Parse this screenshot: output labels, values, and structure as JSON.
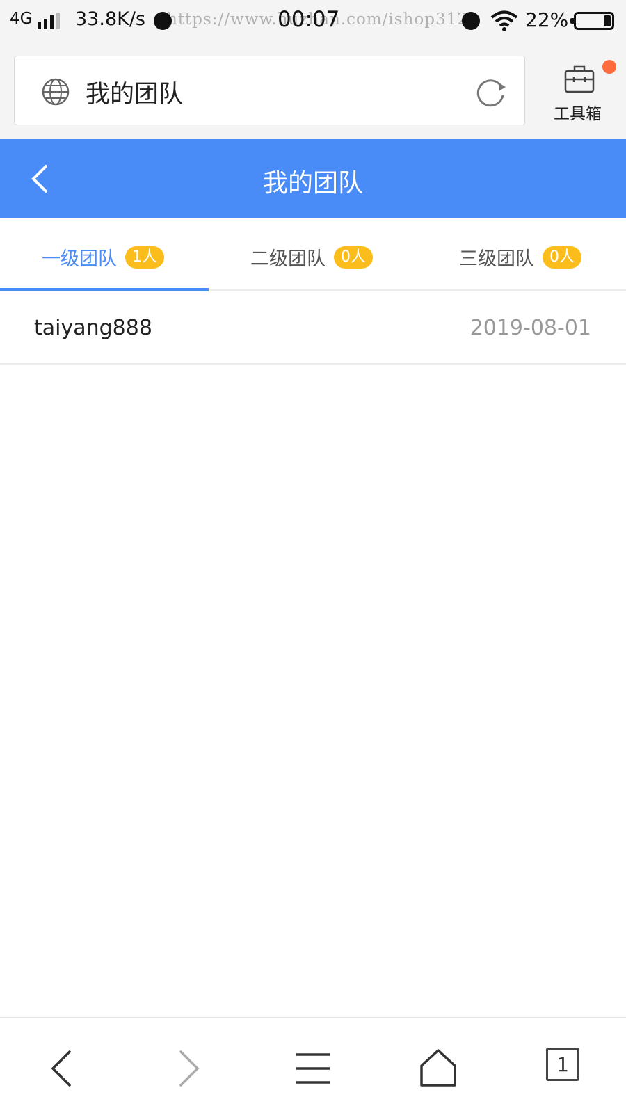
{
  "status_bar": {
    "network": "4G",
    "speed": "33.8K/s",
    "url_watermark": "https://www.huzhan.com/ishop3129",
    "time": "00:07",
    "battery": "22%"
  },
  "browser": {
    "address_title": "我的团队",
    "toolbox_label": "工具箱"
  },
  "header": {
    "title": "我的团队"
  },
  "tabs": [
    {
      "label": "一级团队",
      "badge": "1人",
      "active": true
    },
    {
      "label": "二级团队",
      "badge": "0人",
      "active": false
    },
    {
      "label": "三级团队",
      "badge": "0人",
      "active": false
    }
  ],
  "members": [
    {
      "name": "taiyang888",
      "date": "2019-08-01"
    }
  ],
  "bottom_nav": {
    "tabs_count": "1"
  },
  "colors": {
    "accent": "#4a8cf7",
    "badge": "#fbbd1c",
    "notification_dot": "#ff6b3d"
  }
}
